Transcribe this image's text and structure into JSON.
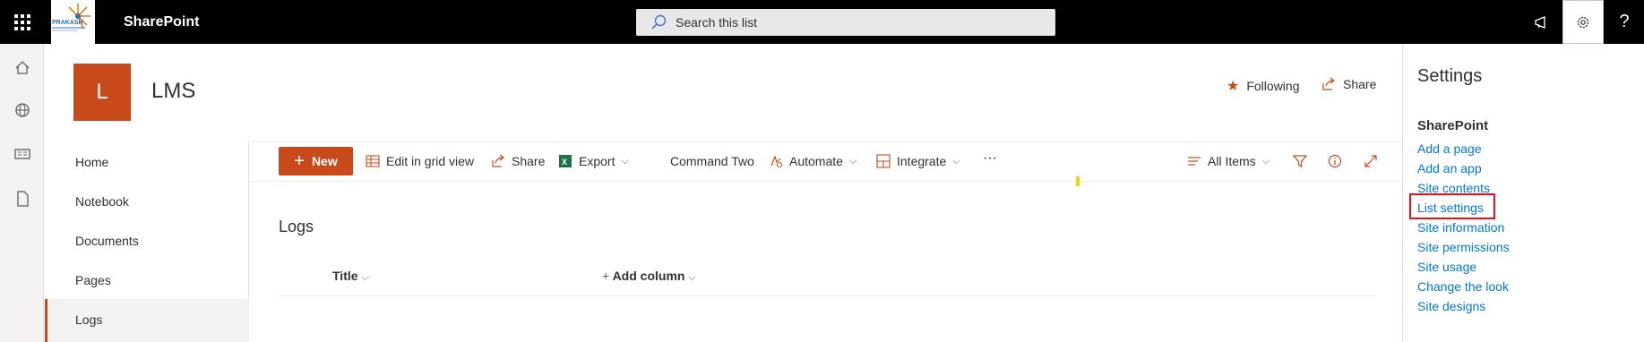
{
  "suite_bar": {
    "app_name": "SharePoint",
    "search_placeholder": "Search this list",
    "logo_text": "PRAKASH",
    "help_label": "?"
  },
  "site": {
    "logo_letter": "L",
    "title": "LMS",
    "following_label": "Following",
    "share_label": "Share"
  },
  "left_nav": {
    "items": [
      "Home",
      "Notebook",
      "Documents",
      "Pages",
      "Logs"
    ],
    "active": "Logs"
  },
  "command_bar": {
    "new_label": "New",
    "edit_grid_label": "Edit in grid view",
    "share_label": "Share",
    "export_label": "Export",
    "command_two_label": "Command Two",
    "automate_label": "Automate",
    "integrate_label": "Integrate",
    "more_label": "···",
    "view_label": "All Items"
  },
  "list": {
    "title": "Logs",
    "columns": [
      "Title",
      "Add column"
    ]
  },
  "settings_pane": {
    "title": "Settings",
    "section": "SharePoint",
    "links": [
      "Add a page",
      "Add an app",
      "Site contents",
      "List settings",
      "Site information",
      "Site permissions",
      "Site usage",
      "Change the look",
      "Site designs"
    ],
    "highlighted": "List settings"
  },
  "colors": {
    "brand": "#c84a1a",
    "link": "#0078d4",
    "highlight_box": "#e0121a"
  }
}
